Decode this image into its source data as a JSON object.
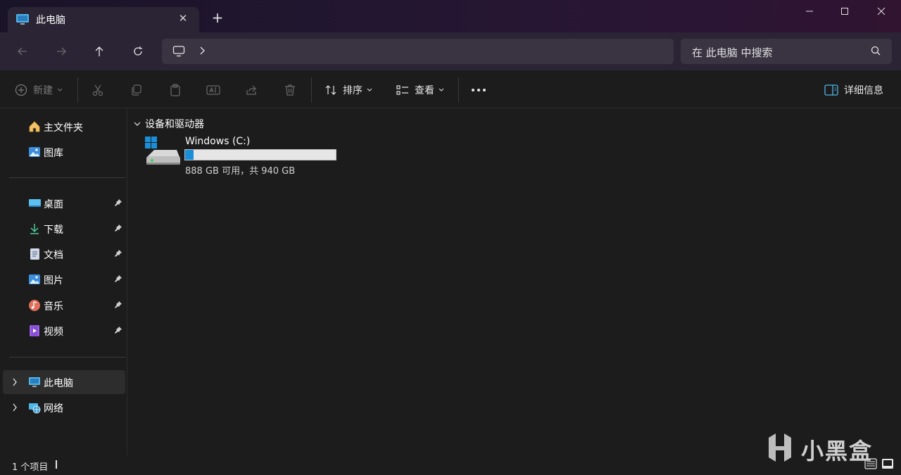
{
  "window": {
    "tab_title": "此电脑",
    "new_tab": "+",
    "tab_close": "✕"
  },
  "nav": {
    "search_placeholder": "在 此电脑 中搜索"
  },
  "commands": {
    "new_label": "新建",
    "sort_label": "排序",
    "view_label": "查看",
    "details_label": "详细信息"
  },
  "sidebar": {
    "items": [
      {
        "label": "主文件夹",
        "icon": "home-icon"
      },
      {
        "label": "图库",
        "icon": "gallery-icon"
      },
      {
        "label": "桌面",
        "icon": "desktop-icon",
        "pinned": true
      },
      {
        "label": "下载",
        "icon": "download-icon",
        "pinned": true
      },
      {
        "label": "文档",
        "icon": "document-icon",
        "pinned": true
      },
      {
        "label": "图片",
        "icon": "pictures-icon",
        "pinned": true
      },
      {
        "label": "音乐",
        "icon": "music-icon",
        "pinned": true
      },
      {
        "label": "视频",
        "icon": "video-icon",
        "pinned": true
      },
      {
        "label": "此电脑",
        "icon": "this-pc-icon",
        "selected": true
      },
      {
        "label": "网络",
        "icon": "network-icon"
      }
    ]
  },
  "content": {
    "section_title": "设备和驱动器",
    "drives": [
      {
        "name": "Windows (C:)",
        "free_text": "888 GB 可用，共 940 GB",
        "used_fraction": 0.055
      }
    ]
  },
  "status": {
    "item_count": "1 个项目"
  },
  "watermark": {
    "text": "小黑盒"
  },
  "colors": {
    "accent": "#1a8fd8",
    "background": "#1c1c1c",
    "toolbar": "#2b2434"
  }
}
